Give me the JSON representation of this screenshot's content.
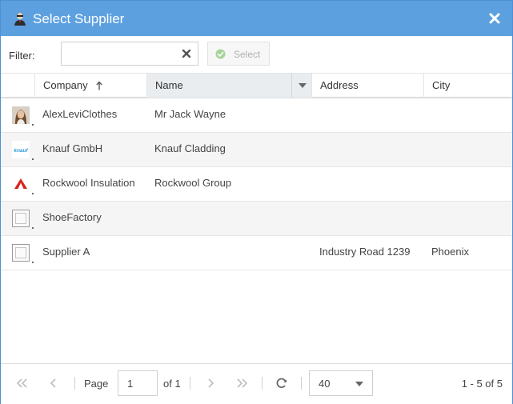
{
  "dialog": {
    "title": "Select Supplier",
    "icon": "user-agent-icon",
    "close_icon": "close-icon"
  },
  "toolbar": {
    "filter_label": "Filter:",
    "filter_value": "",
    "filter_placeholder": "",
    "select_label": "Select"
  },
  "columns": [
    {
      "label": "Company",
      "sorted": "ascending"
    },
    {
      "label": "Name",
      "active": true
    },
    {
      "label": "Address"
    },
    {
      "label": "City"
    }
  ],
  "rows": [
    {
      "thumb": "person-photo-icon",
      "company": "AlexLeviClothes",
      "name": "Mr Jack Wayne",
      "address": "",
      "city": ""
    },
    {
      "thumb": "knauf-logo-icon",
      "thumb_text": "knauf",
      "company": "Knauf GmbH",
      "name": "Knauf Cladding",
      "address": "",
      "city": ""
    },
    {
      "thumb": "rockwool-logo-icon",
      "company": "Rockwool Insulation",
      "name": "Rockwool Group",
      "address": "",
      "city": ""
    },
    {
      "thumb": "placeholder-image-icon",
      "company": "ShoeFactory",
      "name": "",
      "address": "",
      "city": ""
    },
    {
      "thumb": "placeholder-image-icon",
      "company": "Supplier A",
      "name": "",
      "address": "Industry Road 1239",
      "city": "Phoenix"
    }
  ],
  "pager": {
    "page_label": "Page",
    "page_value": "1",
    "of_label": "of 1",
    "page_size": "40",
    "range_text": "1 - 5 of 5"
  },
  "colors": {
    "titlebar": "#5da0e0",
    "accent_border": "#4f8fd3",
    "row_alt": "#f5f5f5"
  }
}
